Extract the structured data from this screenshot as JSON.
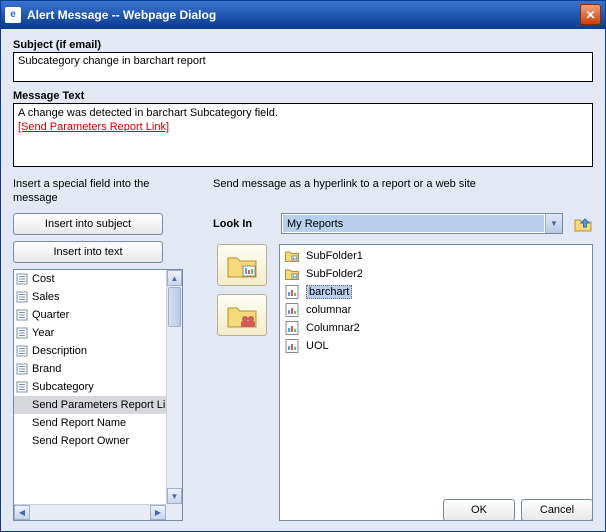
{
  "title": "Alert Message -- Webpage Dialog",
  "subject": {
    "label": "Subject (if email)",
    "value": "Subcategory change in barchart report"
  },
  "message": {
    "label": "Message Text",
    "value": "A change was detected in barchart Subcategory field.",
    "link": "[Send Parameters Report Link]"
  },
  "insert": {
    "hint": "Insert a special field into the message",
    "btn_subject": "Insert into subject",
    "btn_text": "Insert into text",
    "fields": [
      "Cost",
      "Sales",
      "Quarter",
      "Year",
      "Description",
      "Brand",
      "Subcategory"
    ],
    "extras": [
      "Send Parameters Report Link",
      "Send Report Name",
      "Send Report Owner"
    ],
    "selected": "Send Parameters Report Link"
  },
  "link": {
    "hint": "Send message as a hyperlink to a report or a web site",
    "lookin_label": "Look In",
    "lookin_value": "My Reports",
    "folders": [
      "SubFolder1",
      "SubFolder2"
    ],
    "reports": [
      "barchart",
      "columnar",
      "Columnar2",
      "UOL"
    ],
    "selected": "barchart"
  },
  "buttons": {
    "ok": "OK",
    "cancel": "Cancel"
  }
}
